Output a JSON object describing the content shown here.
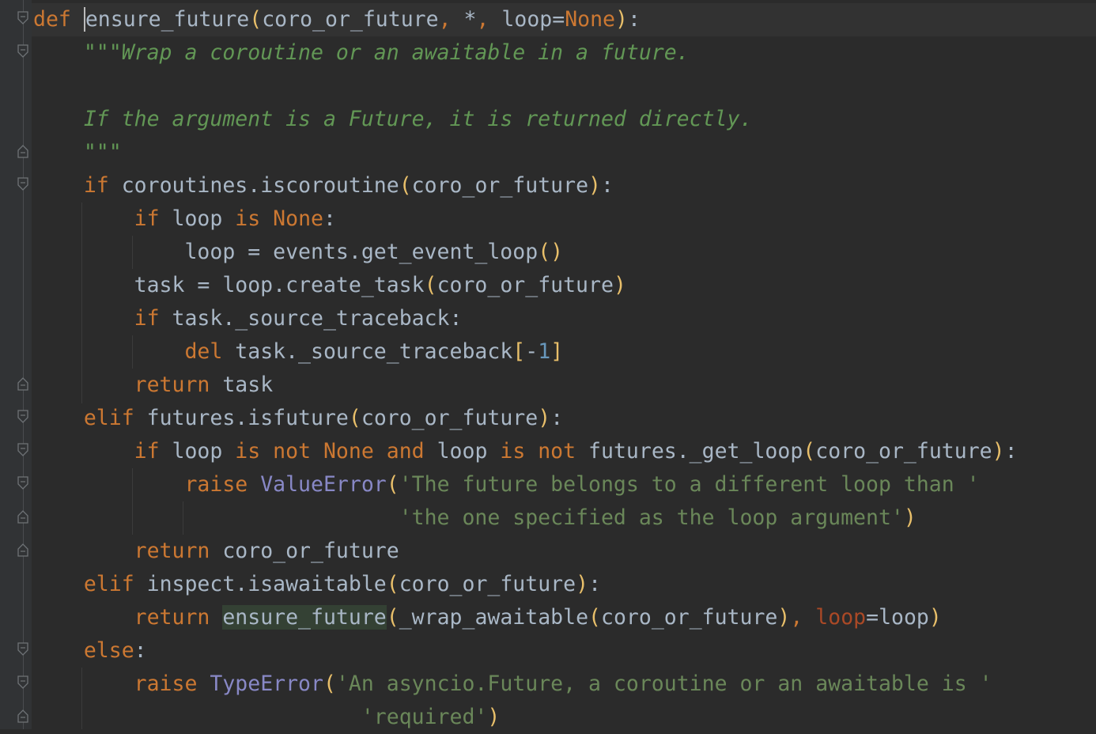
{
  "editor": {
    "language": "python",
    "colors": {
      "background": "#2b2b2b",
      "gutter": "#313335",
      "keyword": "#cc7832",
      "docstring": "#629755",
      "string": "#6a8759",
      "identifier": "#a9b7c6",
      "builtin_class": "#8888c6",
      "number": "#6897bb",
      "paren": "#e8bf6a",
      "keyword_argument": "#aa4926"
    },
    "lines": [
      [
        [
          "kw",
          "def "
        ],
        [
          "caret",
          "e"
        ],
        [
          "plain",
          "nsure_future"
        ],
        [
          "par",
          "("
        ],
        [
          "plain",
          "coro_or_future"
        ],
        [
          "kw",
          ", "
        ],
        [
          "plain",
          "*"
        ],
        [
          "kw",
          ", "
        ],
        [
          "plain",
          "loop="
        ],
        [
          "kw",
          "None"
        ],
        [
          "par",
          ")"
        ],
        [
          "plain",
          ":"
        ]
      ],
      [
        [
          "plain",
          "    "
        ],
        [
          "doc",
          "\"\"\"Wrap a coroutine or an awaitable in a future."
        ]
      ],
      [],
      [
        [
          "plain",
          "    "
        ],
        [
          "doc",
          "If the argument is a Future, it is returned directly."
        ]
      ],
      [
        [
          "plain",
          "    "
        ],
        [
          "doc",
          "\"\"\""
        ]
      ],
      [
        [
          "plain",
          "    "
        ],
        [
          "kw",
          "if "
        ],
        [
          "plain",
          "coroutines.iscoroutine"
        ],
        [
          "par",
          "("
        ],
        [
          "plain",
          "coro_or_future"
        ],
        [
          "par",
          ")"
        ],
        [
          "plain",
          ":"
        ]
      ],
      [
        [
          "plain",
          "        "
        ],
        [
          "kw",
          "if "
        ],
        [
          "plain",
          "loop "
        ],
        [
          "kw",
          "is None"
        ],
        [
          "plain",
          ":"
        ]
      ],
      [
        [
          "plain",
          "            loop = events.get_event_loop"
        ],
        [
          "par",
          "()"
        ]
      ],
      [
        [
          "plain",
          "        task = loop.create_task"
        ],
        [
          "par",
          "("
        ],
        [
          "plain",
          "coro_or_future"
        ],
        [
          "par",
          ")"
        ]
      ],
      [
        [
          "plain",
          "        "
        ],
        [
          "kw",
          "if "
        ],
        [
          "plain",
          "task._source_traceback:"
        ]
      ],
      [
        [
          "plain",
          "            "
        ],
        [
          "kw",
          "del "
        ],
        [
          "plain",
          "task._source_traceback"
        ],
        [
          "par",
          "["
        ],
        [
          "plain",
          "-"
        ],
        [
          "num",
          "1"
        ],
        [
          "par",
          "]"
        ]
      ],
      [
        [
          "plain",
          "        "
        ],
        [
          "kw",
          "return "
        ],
        [
          "plain",
          "task"
        ]
      ],
      [
        [
          "plain",
          "    "
        ],
        [
          "kw",
          "elif "
        ],
        [
          "plain",
          "futures.isfuture"
        ],
        [
          "par",
          "("
        ],
        [
          "plain",
          "coro_or_future"
        ],
        [
          "par",
          ")"
        ],
        [
          "plain",
          ":"
        ]
      ],
      [
        [
          "plain",
          "        "
        ],
        [
          "kw",
          "if "
        ],
        [
          "plain",
          "loop "
        ],
        [
          "kw",
          "is not None and "
        ],
        [
          "plain",
          "loop "
        ],
        [
          "kw",
          "is not "
        ],
        [
          "plain",
          "futures._get_loop"
        ],
        [
          "par",
          "("
        ],
        [
          "plain",
          "coro_or_future"
        ],
        [
          "par",
          ")"
        ],
        [
          "plain",
          ":"
        ]
      ],
      [
        [
          "plain",
          "            "
        ],
        [
          "kw",
          "raise "
        ],
        [
          "cls",
          "ValueError"
        ],
        [
          "par",
          "("
        ],
        [
          "str",
          "'The future belongs to a different loop than '"
        ]
      ],
      [
        [
          "plain",
          "                             "
        ],
        [
          "str",
          "'the one specified as the loop argument'"
        ],
        [
          "par",
          ")"
        ]
      ],
      [
        [
          "plain",
          "        "
        ],
        [
          "kw",
          "return "
        ],
        [
          "plain",
          "coro_or_future"
        ]
      ],
      [
        [
          "plain",
          "    "
        ],
        [
          "kw",
          "elif "
        ],
        [
          "plain",
          "inspect.isawaitable"
        ],
        [
          "par",
          "("
        ],
        [
          "plain",
          "coro_or_future"
        ],
        [
          "par",
          ")"
        ],
        [
          "plain",
          ":"
        ]
      ],
      [
        [
          "plain",
          "        "
        ],
        [
          "kw",
          "return "
        ],
        [
          "hl",
          "ensure_future"
        ],
        [
          "par",
          "("
        ],
        [
          "plain",
          "_wrap_awaitable"
        ],
        [
          "par",
          "("
        ],
        [
          "plain",
          "coro_or_future"
        ],
        [
          "par",
          ")"
        ],
        [
          "kw",
          ", "
        ],
        [
          "kwarg",
          "loop"
        ],
        [
          "plain",
          "=loop"
        ],
        [
          "par",
          ")"
        ]
      ],
      [
        [
          "plain",
          "    "
        ],
        [
          "kw",
          "else"
        ],
        [
          "plain",
          ":"
        ]
      ],
      [
        [
          "plain",
          "        "
        ],
        [
          "kw",
          "raise "
        ],
        [
          "cls",
          "TypeError"
        ],
        [
          "par",
          "("
        ],
        [
          "str",
          "'An asyncio.Future, a coroutine or an awaitable is '"
        ]
      ],
      [
        [
          "plain",
          "                          "
        ],
        [
          "str",
          "'required'"
        ],
        [
          "par",
          ")"
        ]
      ]
    ]
  }
}
